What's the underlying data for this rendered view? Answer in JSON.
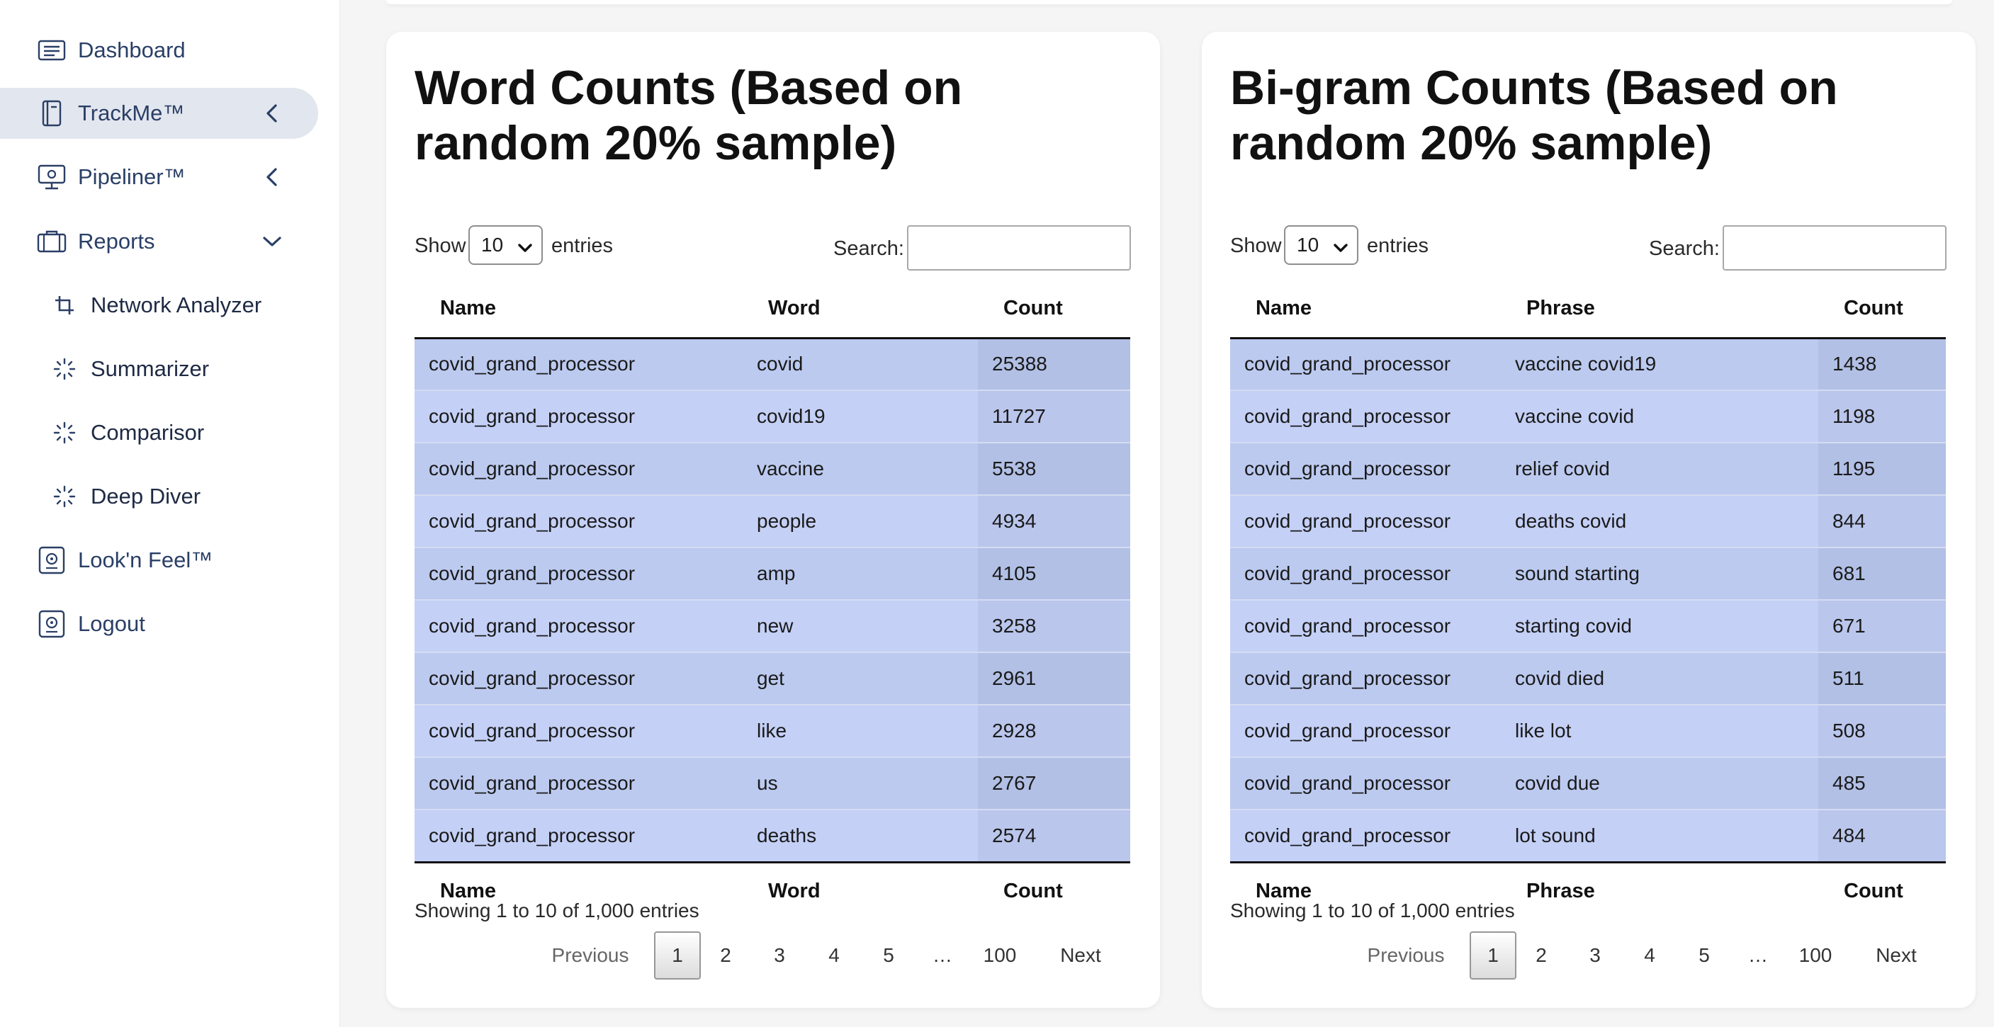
{
  "sidebar": {
    "items": [
      {
        "label": "Dashboard"
      },
      {
        "label": "TrackMe™"
      },
      {
        "label": "Pipeliner™"
      },
      {
        "label": "Reports"
      },
      {
        "label": "Network Analyzer"
      },
      {
        "label": "Summarizer"
      },
      {
        "label": "Comparisor"
      },
      {
        "label": "Deep Diver"
      },
      {
        "label": "Look'n Feel™"
      },
      {
        "label": "Logout"
      }
    ]
  },
  "word_card": {
    "title": "Word Counts (Based on random 20% sample)",
    "show_label": "Show",
    "length_value": "10",
    "entries_label": "entries",
    "search_label": "Search:",
    "search_value": "",
    "columns": [
      "Name",
      "Word",
      "Count"
    ],
    "rows": [
      [
        "covid_grand_processor",
        "covid",
        "25388"
      ],
      [
        "covid_grand_processor",
        "covid19",
        "11727"
      ],
      [
        "covid_grand_processor",
        "vaccine",
        "5538"
      ],
      [
        "covid_grand_processor",
        "people",
        "4934"
      ],
      [
        "covid_grand_processor",
        "amp",
        "4105"
      ],
      [
        "covid_grand_processor",
        "new",
        "3258"
      ],
      [
        "covid_grand_processor",
        "get",
        "2961"
      ],
      [
        "covid_grand_processor",
        "like",
        "2928"
      ],
      [
        "covid_grand_processor",
        "us",
        "2767"
      ],
      [
        "covid_grand_processor",
        "deaths",
        "2574"
      ]
    ],
    "info": "Showing 1 to 10 of 1,000 entries",
    "pager": {
      "previous": "Previous",
      "pages": [
        "1",
        "2",
        "3",
        "4",
        "5"
      ],
      "ellipsis": "…",
      "last": "100",
      "next": "Next",
      "current": "1"
    }
  },
  "bigram_card": {
    "title": "Bi-gram Counts (Based on random 20% sample)",
    "show_label": "Show",
    "length_value": "10",
    "entries_label": "entries",
    "search_label": "Search:",
    "search_value": "",
    "columns": [
      "Name",
      "Phrase",
      "Count"
    ],
    "rows": [
      [
        "covid_grand_processor",
        "vaccine covid19",
        "1438"
      ],
      [
        "covid_grand_processor",
        "vaccine covid",
        "1198"
      ],
      [
        "covid_grand_processor",
        "relief covid",
        "1195"
      ],
      [
        "covid_grand_processor",
        "deaths covid",
        "844"
      ],
      [
        "covid_grand_processor",
        "sound starting",
        "681"
      ],
      [
        "covid_grand_processor",
        "starting covid",
        "671"
      ],
      [
        "covid_grand_processor",
        "covid died",
        "511"
      ],
      [
        "covid_grand_processor",
        "like lot",
        "508"
      ],
      [
        "covid_grand_processor",
        "covid due",
        "485"
      ],
      [
        "covid_grand_processor",
        "lot sound",
        "484"
      ]
    ],
    "info": "Showing 1 to 10 of 1,000 entries",
    "pager": {
      "previous": "Previous",
      "pages": [
        "1",
        "2",
        "3",
        "4",
        "5"
      ],
      "ellipsis": "…",
      "last": "100",
      "next": "Next",
      "current": "1"
    }
  }
}
